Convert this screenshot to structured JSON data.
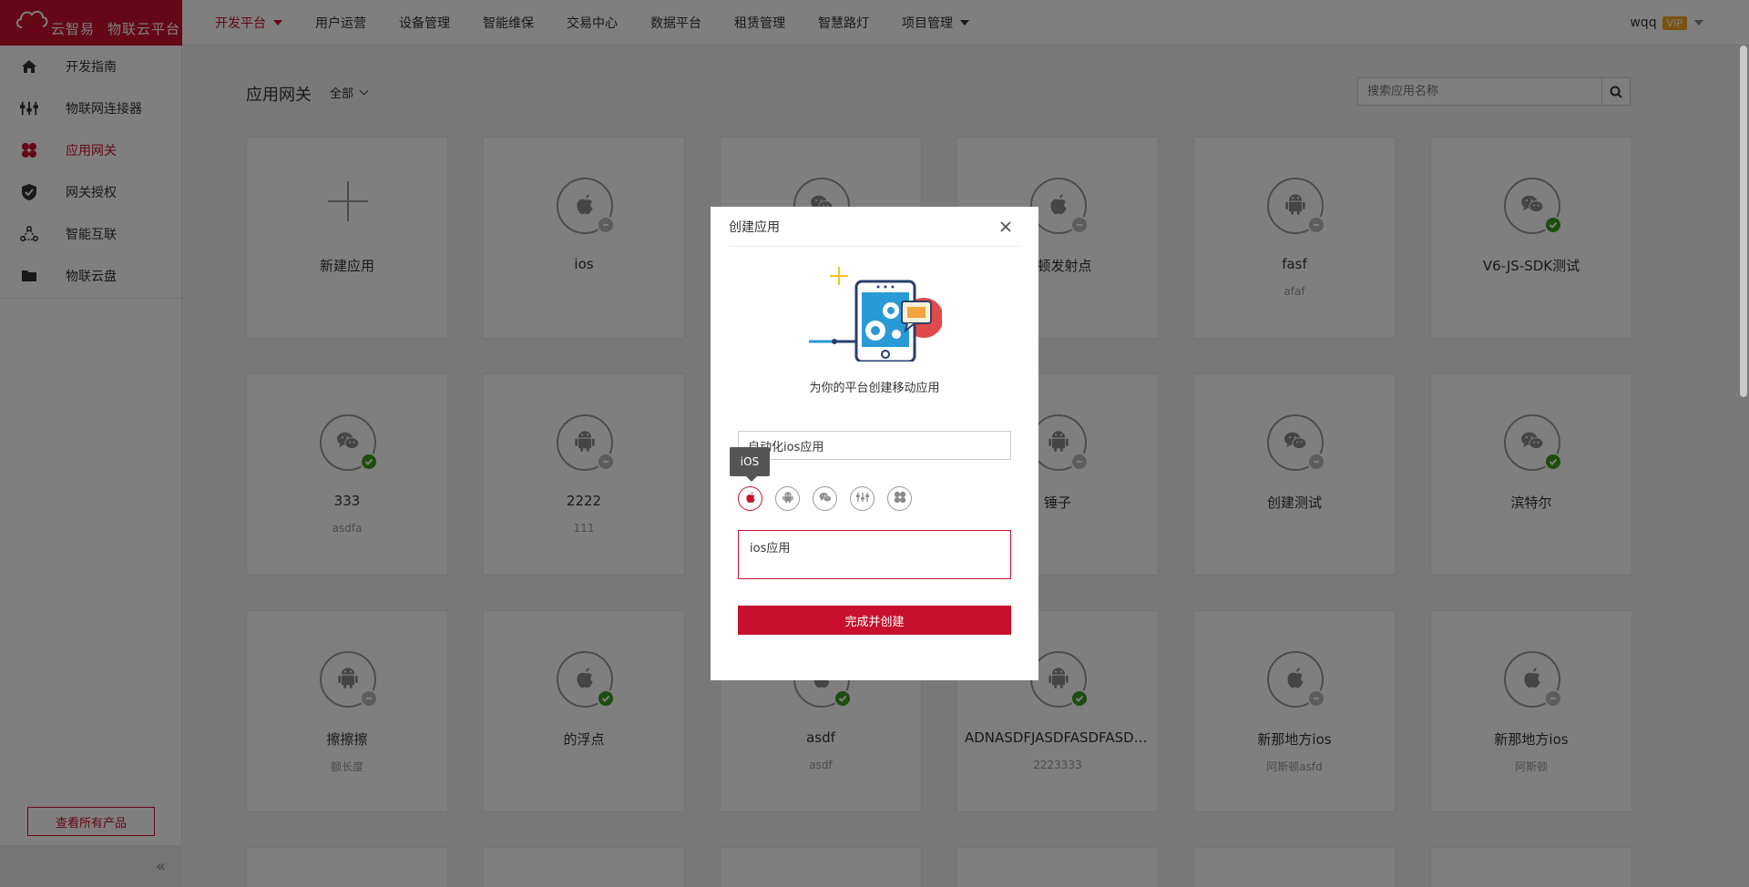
{
  "brand": {
    "name": "云智易",
    "platform": "物联云平台"
  },
  "nav": [
    {
      "label": "开发平台",
      "active": true,
      "dropdown": true
    },
    {
      "label": "用户运营"
    },
    {
      "label": "设备管理"
    },
    {
      "label": "智能维保"
    },
    {
      "label": "交易中心"
    },
    {
      "label": "数据平台"
    },
    {
      "label": "租赁管理"
    },
    {
      "label": "智慧路灯"
    },
    {
      "label": "项目管理",
      "dropdown": true
    }
  ],
  "user": {
    "name": "wqq",
    "badge": "VIP"
  },
  "sidebar": {
    "items": [
      {
        "label": "开发指南",
        "icon": "home-icon"
      },
      {
        "label": "物联网连接器",
        "icon": "connector-icon"
      },
      {
        "label": "应用网关",
        "icon": "app-gateway-icon",
        "active": true
      },
      {
        "label": "网关授权",
        "icon": "shield-check-icon"
      },
      {
        "label": "智能互联",
        "icon": "network-icon"
      },
      {
        "label": "物联云盘",
        "icon": "folder-icon"
      }
    ],
    "all_products": "查看所有产品",
    "collapse": "«"
  },
  "main": {
    "title": "应用网关",
    "filter": "全部",
    "search_placeholder": "搜索应用名称",
    "cards": [
      {
        "name": "新建应用",
        "type": "new"
      },
      {
        "name": "ios",
        "desc": "",
        "type": "apple",
        "status": "off"
      },
      {
        "name": "",
        "desc": "",
        "type": "wechat",
        "status": "off"
      },
      {
        "name": "新顿发射点",
        "desc": "",
        "type": "apple",
        "status": "off"
      },
      {
        "name": "fasf",
        "desc": "afaf",
        "type": "android",
        "status": "off"
      },
      {
        "name": "V6-JS-SDK测试",
        "desc": "",
        "type": "wechat",
        "status": "ok"
      },
      {
        "name": "333",
        "desc": "asdfa",
        "type": "wechat",
        "status": "ok"
      },
      {
        "name": "2222",
        "desc": "111",
        "type": "android",
        "status": "off"
      },
      {
        "name": "",
        "desc": "",
        "type": "android",
        "status": "off"
      },
      {
        "name": "锤子",
        "desc": "",
        "type": "android",
        "status": "off"
      },
      {
        "name": "创建测试",
        "desc": "",
        "type": "wechat",
        "status": "off"
      },
      {
        "name": "滨特尔",
        "desc": "",
        "type": "wechat",
        "status": "ok"
      },
      {
        "name": "擦擦擦",
        "desc": "额长度",
        "type": "android",
        "status": "off"
      },
      {
        "name": "的浮点",
        "desc": "",
        "type": "apple",
        "status": "ok"
      },
      {
        "name": "asdf",
        "desc": "asdf",
        "type": "apple",
        "status": "ok"
      },
      {
        "name": "ADNASDFJASDFASDFASDF...",
        "desc": "2223333",
        "type": "android",
        "status": "ok"
      },
      {
        "name": "新那地方ios",
        "desc": "阿斯顿asfd",
        "type": "apple",
        "status": "off"
      },
      {
        "name": "新那地方ios",
        "desc": "阿斯顿",
        "type": "apple",
        "status": "off"
      }
    ]
  },
  "modal": {
    "title": "创建应用",
    "subtitle": "为你的平台创建移动应用",
    "name_value": "自动化ios应用",
    "tooltip": "iOS",
    "platforms": [
      {
        "icon": "apple-icon",
        "selected": true
      },
      {
        "icon": "android-icon"
      },
      {
        "icon": "wechat-icon"
      },
      {
        "icon": "connector-icon"
      },
      {
        "icon": "clover-icon"
      }
    ],
    "description_value": "ios应用",
    "submit_label": "完成并创建"
  },
  "colors": {
    "accent": "#c8102e",
    "ok": "#3a9a1e",
    "vip": "#f5a623"
  }
}
